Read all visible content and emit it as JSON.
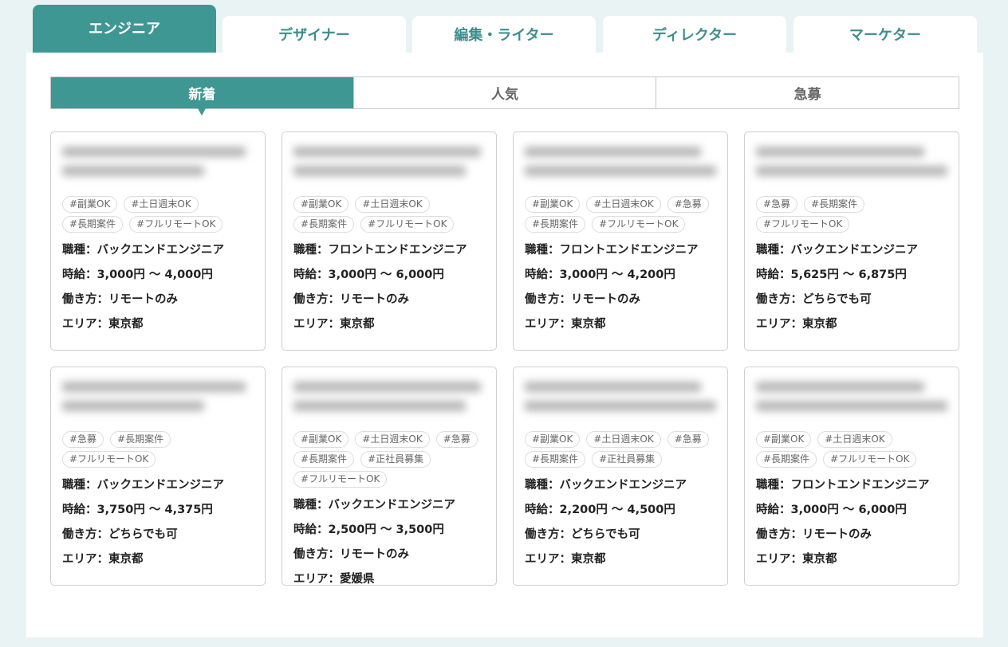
{
  "category_tabs": [
    {
      "label": "エンジニア",
      "active": true
    },
    {
      "label": "デザイナー",
      "active": false
    },
    {
      "label": "編集・ライター",
      "active": false
    },
    {
      "label": "ディレクター",
      "active": false
    },
    {
      "label": "マーケター",
      "active": false
    }
  ],
  "sort_tabs": [
    {
      "label": "新着",
      "active": true
    },
    {
      "label": "人気",
      "active": false
    },
    {
      "label": "急募",
      "active": false
    }
  ],
  "field_labels": {
    "job_type": "職種：",
    "hourly_wage": "時給：",
    "work_style": "働き方：",
    "area": "エリア："
  },
  "wage_separator": " ～ ",
  "colors": {
    "accent": "#3f9793",
    "accent_text": "#3c8e8d",
    "background": "#eaf3f4"
  },
  "cards": [
    {
      "tags": [
        "#副業OK",
        "#土日週末OK",
        "#長期案件",
        "#フルリモートOK"
      ],
      "job_type": "バックエンドエンジニア",
      "wage_min": "3,000円",
      "wage_max": "4,000円",
      "work_style": "リモートのみ",
      "area": "東京都"
    },
    {
      "tags": [
        "#副業OK",
        "#土日週末OK",
        "#長期案件",
        "#フルリモートOK"
      ],
      "job_type": "フロントエンドエンジニア",
      "wage_min": "3,000円",
      "wage_max": "6,000円",
      "work_style": "リモートのみ",
      "area": "東京都"
    },
    {
      "tags": [
        "#副業OK",
        "#土日週末OK",
        "#急募",
        "#長期案件",
        "#フルリモートOK"
      ],
      "job_type": "フロントエンドエンジニア",
      "wage_min": "3,000円",
      "wage_max": "4,200円",
      "work_style": "リモートのみ",
      "area": "東京都"
    },
    {
      "tags": [
        "#急募",
        "#長期案件",
        "#フルリモートOK"
      ],
      "job_type": "バックエンドエンジニア",
      "wage_min": "5,625円",
      "wage_max": "6,875円",
      "work_style": "どちらでも可",
      "area": "東京都"
    },
    {
      "tags": [
        "#急募",
        "#長期案件",
        "#フルリモートOK"
      ],
      "job_type": "バックエンドエンジニア",
      "wage_min": "3,750円",
      "wage_max": "4,375円",
      "work_style": "どちらでも可",
      "area": "東京都"
    },
    {
      "tags": [
        "#副業OK",
        "#土日週末OK",
        "#急募",
        "#長期案件",
        "#正社員募集",
        "#フルリモートOK"
      ],
      "job_type": "バックエンドエンジニア",
      "wage_min": "2,500円",
      "wage_max": "3,500円",
      "work_style": "リモートのみ",
      "area": "愛媛県"
    },
    {
      "tags": [
        "#副業OK",
        "#土日週末OK",
        "#急募",
        "#長期案件",
        "#正社員募集"
      ],
      "job_type": "バックエンドエンジニア",
      "wage_min": "2,200円",
      "wage_max": "4,500円",
      "work_style": "どちらでも可",
      "area": "東京都"
    },
    {
      "tags": [
        "#副業OK",
        "#土日週末OK",
        "#長期案件",
        "#フルリモートOK"
      ],
      "job_type": "フロントエンドエンジニア",
      "wage_min": "3,000円",
      "wage_max": "6,000円",
      "work_style": "リモートのみ",
      "area": "東京都"
    }
  ]
}
